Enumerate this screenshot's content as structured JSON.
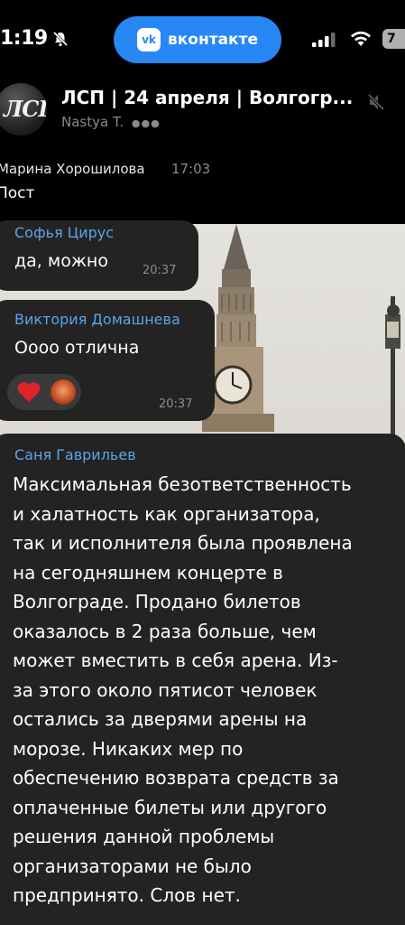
{
  "status_bar": {
    "time": "1:19",
    "vk_label": "вконтакте",
    "vk_logo": "vk",
    "battery": "7",
    "icons": [
      "bell-off-icon",
      "signal-icon",
      "wifi-icon",
      "battery-icon"
    ]
  },
  "header": {
    "title": "ЛСП | 24 апреля | Волгогр...",
    "subtitle": "Nastya T.",
    "typing_indicator": "●●●",
    "avatar_text": "ЛСП"
  },
  "pinned": {
    "author": "Марина Хорошилова",
    "time": "17:03",
    "text": "Пост"
  },
  "messages": [
    {
      "author": "Софья Цирус",
      "text": "да, можно",
      "time": "20:37"
    },
    {
      "author": "Виктория Домашнева",
      "text": "Оооо отлична",
      "time": "20:37",
      "reactions": [
        "heart",
        "avatar"
      ]
    },
    {
      "author": "Саня Гаврильев",
      "lines": [
        "Максимальная безответственность",
        "и халатность как  организатора,",
        "так и исполнителя была проявлена",
        "на сегодняшнем концерте в",
        "Волгограде. Продано билетов",
        "оказалось в 2 раза больше, чем",
        "может вместить в себя арена. Из-",
        "за этого около пятисот человек",
        "остались за дверями арены на",
        "морозе. Никаких мер по",
        "обеспечению возврата средств за",
        "оплаченные билеты или другого",
        "решения данной проблемы",
        "организаторами не было",
        "предпринято. Слов нет."
      ]
    }
  ],
  "colors": {
    "vk_blue": "#2787f5",
    "author_blue": "#5fa3e8",
    "bubble": "#232323",
    "heart": "#e0222a"
  }
}
